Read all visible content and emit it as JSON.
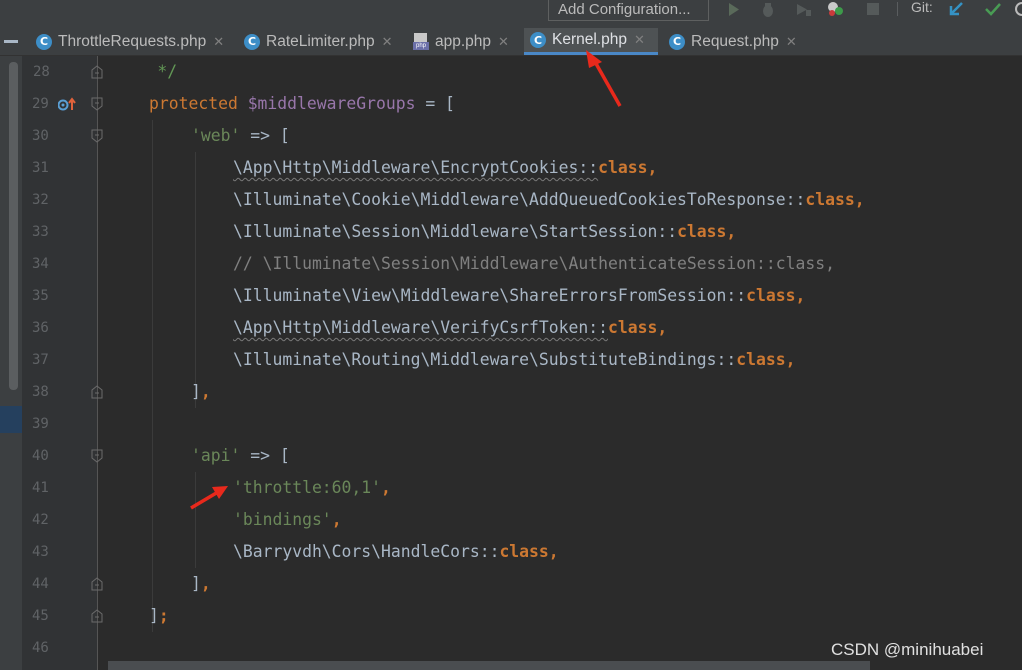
{
  "toolbar": {
    "add_configuration_label": "Add Configuration...",
    "run_icon": "play-icon",
    "debug_icon": "bug-icon",
    "coverage_icon": "coverage-icon",
    "profile_icon": "profiler-icon",
    "stop_icon": "stop-icon",
    "git_label": "Git:",
    "git_update_icon": "arrow-down-left-icon",
    "git_commit_icon": "check-icon"
  },
  "tabs": [
    {
      "label": "ThrottleRequests.php",
      "icon": "class-icon",
      "active": false
    },
    {
      "label": "RateLimiter.php",
      "icon": "class-icon",
      "active": false
    },
    {
      "label": "app.php",
      "icon": "php-file-icon",
      "active": false
    },
    {
      "label": "Kernel.php",
      "icon": "class-icon",
      "active": true
    },
    {
      "label": "Request.php",
      "icon": "class-icon",
      "active": false
    }
  ],
  "editor": {
    "line_numbers": [
      "28",
      "29",
      "30",
      "31",
      "32",
      "33",
      "34",
      "35",
      "36",
      "37",
      "38",
      "39",
      "40",
      "41",
      "42",
      "43",
      "44",
      "45",
      "46"
    ],
    "lines": {
      "l28": {
        "doc": "*/"
      },
      "l29": {
        "kw": "protected",
        "var": "$middlewareGroups",
        "rest": " = ["
      },
      "l30": {
        "str": "'web'",
        "rest": " => ["
      },
      "l31": {
        "text": "\\App\\Http\\Middleware\\EncryptCookies::",
        "kw": "class",
        "punct": ","
      },
      "l32": {
        "text": "\\Illuminate\\Cookie\\Middleware\\AddQueuedCookiesToResponse::",
        "kw": "class",
        "punct": ","
      },
      "l33": {
        "text": "\\Illuminate\\Session\\Middleware\\StartSession::",
        "kw": "class",
        "punct": ","
      },
      "l34": {
        "comment": "// \\Illuminate\\Session\\Middleware\\AuthenticateSession::class,"
      },
      "l35": {
        "text": "\\Illuminate\\View\\Middleware\\ShareErrorsFromSession::",
        "kw": "class",
        "punct": ","
      },
      "l36": {
        "text": "\\App\\Http\\Middleware\\VerifyCsrfToken::",
        "kw": "class",
        "punct": ","
      },
      "l37": {
        "text": "\\Illuminate\\Routing\\Middleware\\SubstituteBindings::",
        "kw": "class",
        "punct": ","
      },
      "l38": {
        "text": "]",
        "punct": ","
      },
      "l40": {
        "str": "'api'",
        "rest": " => ["
      },
      "l41": {
        "str": "'throttle:60,1'",
        "punct": ","
      },
      "l42": {
        "str": "'bindings'",
        "punct": ","
      },
      "l43": {
        "text": "\\Barryvdh\\Cors\\HandleCors::",
        "kw": "class",
        "punct": ","
      },
      "l44": {
        "text": "]",
        "punct": ","
      },
      "l45": {
        "text": "]",
        "punct": ";"
      }
    }
  },
  "watermark": "CSDN @minihuabei",
  "colors": {
    "keyword": "#cc7832",
    "variable": "#9876aa",
    "string": "#6a8759",
    "comment": "#808080",
    "annotation_arrow": "#e8291c",
    "active_tab_underline": "#4a88c7"
  }
}
